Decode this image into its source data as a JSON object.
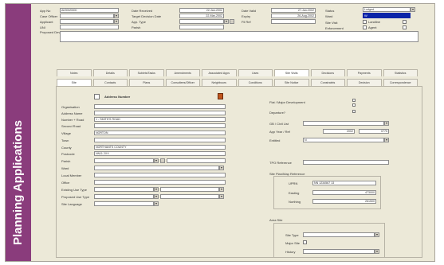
{
  "sidebar": {
    "title": "Planning Applications"
  },
  "header": {
    "app_no_label": "App No",
    "app_no_value": "AI/000/0000",
    "date_received_label": "Date Received",
    "date_received_value": "22-Jan-2002",
    "date_valid_label": "Date Valid",
    "date_valid_value": "27-Jan-2002",
    "status_label": "Status",
    "case_officer_label": "Case Officer",
    "target_decision_label": "Target Decision Date",
    "target_decision_value": "22-Mar-2002",
    "expiry_label": "Expiry",
    "expiry_value": "26-Aug-2002",
    "app_type_label": "App. Type",
    "file_ref_label": "Fil Ref",
    "applicant_label": "Applicant",
    "applicant_value": "",
    "ward_label": "Ward",
    "ward_value": "",
    "site_visit_label": "Site Visit",
    "landline_label": "Landline",
    "agent_label": "Agent",
    "uni_label": "UNI",
    "parish_label": "Parish",
    "enforcement_label": "Enforcement",
    "proposed_dev_label": "Proposed Development",
    "status_list": [
      {
        "text": "Lodged"
      },
      {
        "text": "W"
      }
    ]
  },
  "tabs_row1": [
    "Notes",
    "Details",
    "Sublets/Tasks",
    "Amendments",
    "Associated Apps",
    "Uses",
    "Site Visits",
    "Decisions",
    "Payments",
    "Statistics"
  ],
  "tabs_row2": [
    "Site",
    "Contacts",
    "Plans",
    "Consultees/Officer",
    "Neighbours",
    "Conditions",
    "Site Notice",
    "Constraints",
    "Decision",
    "Correspondence"
  ],
  "address": {
    "header_label": "Address Number",
    "organisation_label": "Organisation",
    "organisation_value": "",
    "address_name_label": "Address Name",
    "address_name_value": "",
    "number_road_label": "Number + Road",
    "number_road_value": "1 - SMITH'S ROAD",
    "second_road_label": "Second Road",
    "second_road_value": "",
    "village_label": "Village",
    "village_value": "NORTON",
    "town_label": "Town",
    "town_value": "",
    "county_label": "County",
    "county_value": "NORTHANTS COUNTY",
    "postcode_label": "Postcode",
    "postcode_value": "NN11 2XX",
    "parish_label": "Parish",
    "parish_value": "",
    "ward_label": "Ward",
    "ward_value": "",
    "local_member_label": "Local Member",
    "local_member_value": "",
    "office_label": "Office",
    "office_value": "",
    "existing_use_label": "Existing Use Type",
    "existing_use_value": "",
    "proposed_use_label": "Proposed Use Type",
    "proposed_use_value": "",
    "site_language_label": "Site Language",
    "site_language_value": ""
  },
  "right": {
    "flat_label": "Flat / Major Development",
    "departure_label": "Departure?",
    "gb_label": "GB / Civil List",
    "app_year_label": "App Year / Ref",
    "app_year_value1": "2002",
    "app_year_value2": "0775",
    "entitled_label": "Entitled",
    "entitled_value": "N",
    "tpo_label": "TPO Reference",
    "tpo_value": "",
    "grid_group_label": "Site Plan/Map Reference",
    "uprn_label": "UPRN",
    "uprn_value": "NN 1234567 13",
    "easting_label": "Easting",
    "easting_value": "473000",
    "northing_label": "Northing",
    "northing_value": "261500",
    "area_group_label": "Area Site",
    "site_type_label": "Site Type",
    "major_site_label": "Major Site",
    "history_label": "History"
  },
  "colors": {
    "sidebar": "#8a3c7c",
    "selection": "#0a24a8",
    "panel": "#ece9d8"
  }
}
